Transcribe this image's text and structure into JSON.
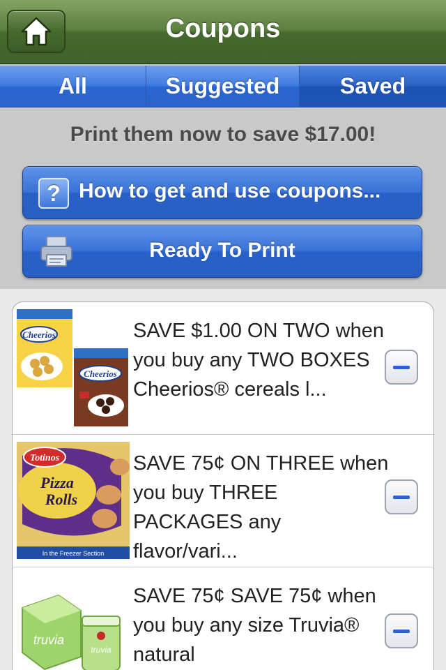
{
  "navbar": {
    "title": "Coupons",
    "home_icon": "home-icon"
  },
  "tabs": [
    {
      "label": "All",
      "selected": false
    },
    {
      "label": "Suggested",
      "selected": false
    },
    {
      "label": "Saved",
      "selected": true
    }
  ],
  "summary": {
    "savings_text": "Print them now to save $17.00!"
  },
  "buttons": {
    "how_to": {
      "label": "How to get and use coupons...",
      "icon": "help-icon"
    },
    "ready_to_print": {
      "label": "Ready To Print",
      "icon": "printer-icon"
    }
  },
  "coupons": [
    {
      "text": "SAVE $1.00 ON TWO when you buy any TWO BOXES Cheerios® cereals l...",
      "image": "cheerios-product-image",
      "action_icon": "minus-icon"
    },
    {
      "text": "SAVE 75¢ ON THREE when you buy THREE PACKAGES any flavor/vari...",
      "image": "totinos-pizza-rolls-product-image",
      "action_icon": "minus-icon"
    },
    {
      "text": "SAVE 75¢ SAVE 75¢ when you buy any size Truvia® natural",
      "image": "truvia-product-image",
      "action_icon": "minus-icon"
    }
  ],
  "colors": {
    "navbar_green": "#466a2d",
    "segment_blue": "#2a66d2",
    "button_blue": "#2760c8",
    "minus_blue": "#2c63d1"
  }
}
